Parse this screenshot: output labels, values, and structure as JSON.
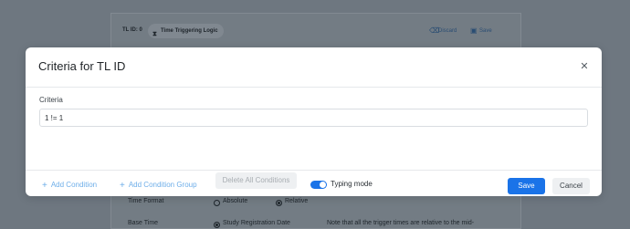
{
  "background": {
    "tl_id_label": "TL ID: 0",
    "chip_label": "Time Triggering Logic",
    "chip_icon": "hourglass-icon",
    "discard_label": "Discard",
    "save_label": "Save",
    "time_format_label": "Time Format",
    "time_format_options": [
      "Absolute",
      "Relative"
    ],
    "base_time_label": "Base Time",
    "base_time_option": "Study Registration Date",
    "base_time_note": "Note that all the trigger times are relative to the mid-"
  },
  "modal": {
    "title": "Criteria for TL ID",
    "field_label": "Criteria",
    "criteria_value": "1 != 1",
    "footer": {
      "add_condition": "Add Condition",
      "add_condition_group": "Add Condition Group",
      "delete_all": "Delete All Conditions",
      "typing_mode_label": "Typing mode",
      "typing_mode_on": true,
      "save": "Save",
      "cancel": "Cancel"
    }
  },
  "colors": {
    "accent": "#1a73e8",
    "link": "#6eaee9",
    "overlay": "#6e7780"
  }
}
